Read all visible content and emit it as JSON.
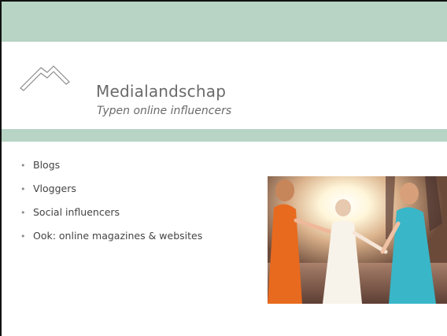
{
  "slide": {
    "title": "Medialandschap",
    "subtitle": "Typen online influencers",
    "bullets": [
      "Blogs",
      "Vloggers",
      "Social influencers",
      "Ook: online magazines & websites"
    ],
    "logo_icon": "house-outline-icon",
    "photo_icon": "photo-people-dancing",
    "colors": {
      "band": "#b7d4c4",
      "text": "#6a6a6a"
    }
  }
}
